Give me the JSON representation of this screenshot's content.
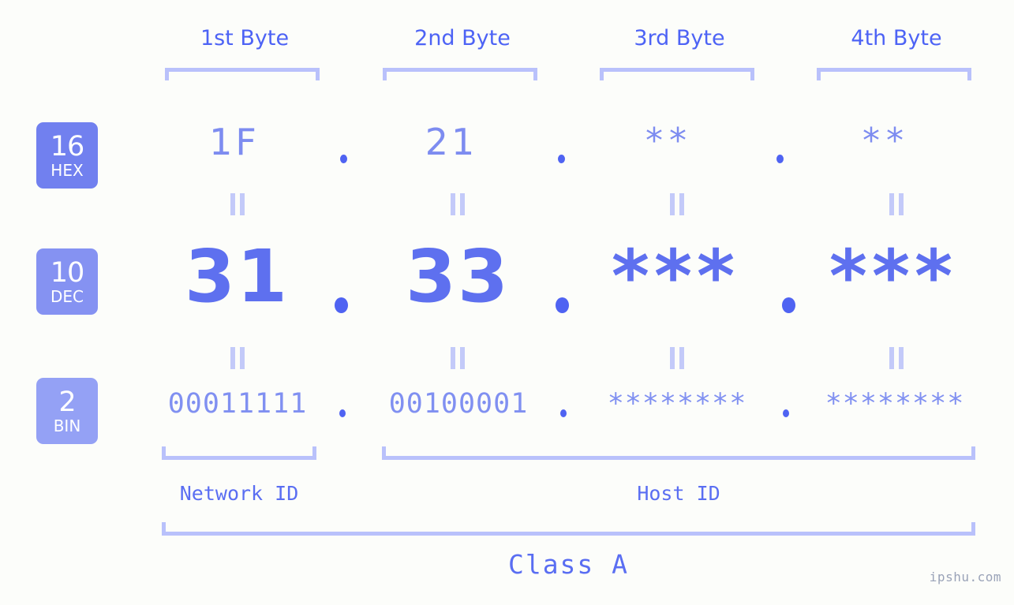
{
  "page": {
    "background_color": "#fcfdfa",
    "accent_color": "#5a6ef2",
    "accent_light_color": "#b9c1fb",
    "watermark": "ipshu.com"
  },
  "byte_headers": [
    {
      "label": "1st Byte"
    },
    {
      "label": "2nd Byte"
    },
    {
      "label": "3rd Byte"
    },
    {
      "label": "4th Byte"
    }
  ],
  "radix_badges": [
    {
      "number": "16",
      "abbr": "HEX",
      "color": "#7180ef"
    },
    {
      "number": "10",
      "abbr": "DEC",
      "color": "#8592f2"
    },
    {
      "number": "2",
      "abbr": "BIN",
      "color": "#94a1f5"
    }
  ],
  "rows": {
    "hex": {
      "values": [
        "1F",
        "21",
        "**",
        "**"
      ],
      "separator": "."
    },
    "dec": {
      "values": [
        "31",
        "33",
        "***",
        "***"
      ],
      "separator": "."
    },
    "bin": {
      "values": [
        "00011111",
        "00100001",
        "********",
        "********"
      ],
      "separator": "."
    }
  },
  "equals_marks": {
    "glyph": "=",
    "count_per_row": 4
  },
  "id_sections": [
    {
      "label": "Network ID"
    },
    {
      "label": "Host ID"
    }
  ],
  "class_section": {
    "label": "Class A"
  }
}
